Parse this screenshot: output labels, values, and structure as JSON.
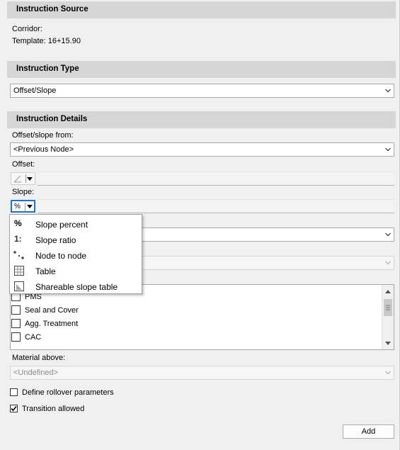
{
  "instruction_source": {
    "header": "Instruction Source",
    "corridor_label": "Corridor:",
    "template_label": "Template: 16+15.90"
  },
  "instruction_type": {
    "header": "Instruction Type",
    "selected": "Offset/Slope"
  },
  "instruction_details": {
    "header": "Instruction Details",
    "offset_slope_from_label": "Offset/slope from:",
    "offset_slope_from_value": "<Previous Node>",
    "offset_label": "Offset:",
    "slope_label": "Slope:",
    "slope_type_glyph": "%",
    "material_above_label": "Material above:",
    "material_above_value": "<Undefined>"
  },
  "slope_type_menu": {
    "items": [
      {
        "label": "Slope percent",
        "icon": "percent-icon"
      },
      {
        "label": "Slope ratio",
        "icon": "ratio-icon"
      },
      {
        "label": "Node to node",
        "icon": "node-to-node-icon"
      },
      {
        "label": "Table",
        "icon": "table-icon"
      },
      {
        "label": "Shareable slope table",
        "icon": "shareable-table-icon"
      }
    ]
  },
  "materials": {
    "items": [
      {
        "label": "PMS",
        "checked": false
      },
      {
        "label": "Seal and Cover",
        "checked": false
      },
      {
        "label": "Agg. Treatment",
        "checked": false
      },
      {
        "label": "CAC",
        "checked": false
      }
    ]
  },
  "options": {
    "define_rollover": {
      "label": "Define rollover parameters",
      "checked": false
    },
    "transition_allowed": {
      "label": "Transition allowed",
      "checked": true
    }
  },
  "buttons": {
    "add": "Add"
  },
  "colors": {
    "header_bg": "#d6d6d6",
    "focus_blue": "#1a73d9"
  }
}
